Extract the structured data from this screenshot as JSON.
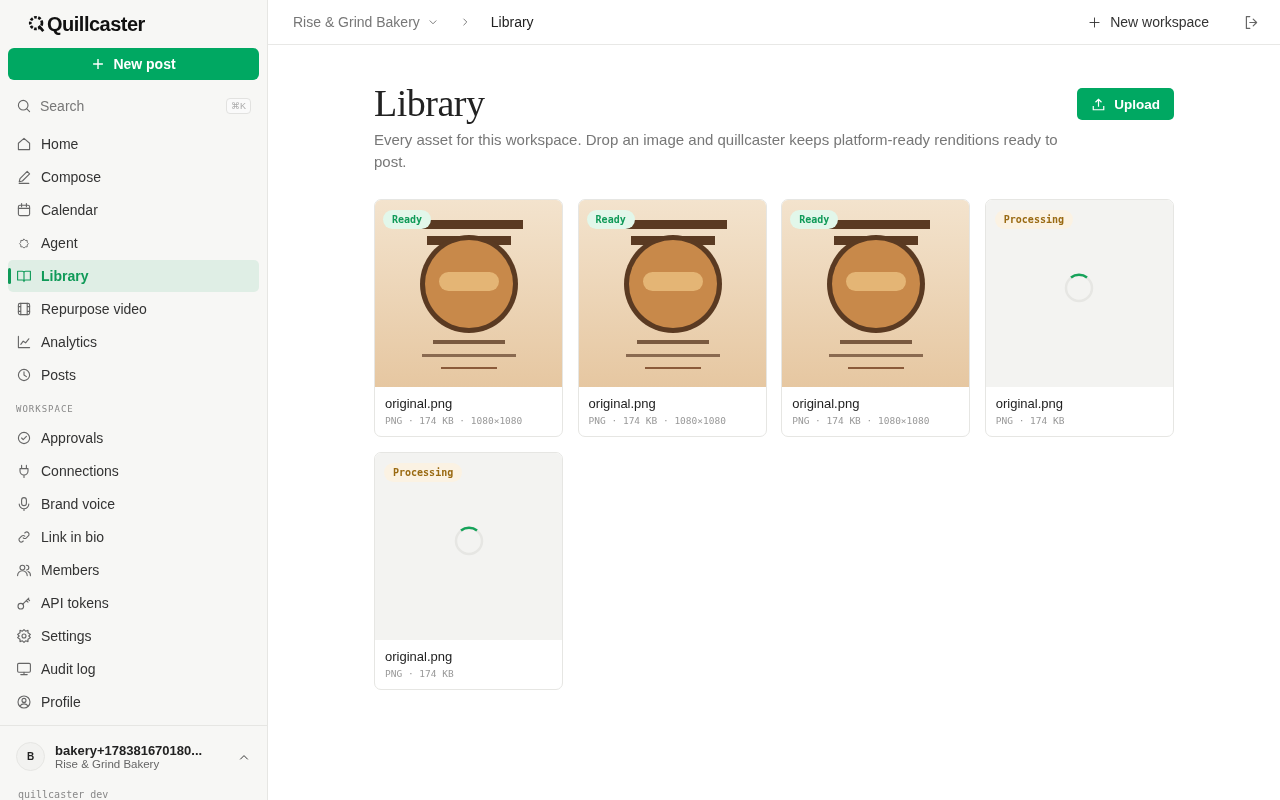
{
  "sidebar": {
    "logo": "Quillcaster",
    "new_post": "New post",
    "search": {
      "placeholder": "Search",
      "shortcut": "⌘K"
    },
    "items": [
      {
        "label": "Home",
        "selected": false
      },
      {
        "label": "Compose",
        "selected": false
      },
      {
        "label": "Calendar",
        "selected": false
      },
      {
        "label": "Agent",
        "selected": false
      },
      {
        "label": "Library",
        "selected": true
      },
      {
        "label": "Repurpose video",
        "selected": false
      },
      {
        "label": "Analytics",
        "selected": false
      },
      {
        "label": "Posts",
        "selected": false
      }
    ],
    "section_label": "WORKSPACE",
    "workspace_items": [
      {
        "label": "Approvals",
        "selected": false
      },
      {
        "label": "Connections",
        "selected": false
      },
      {
        "label": "Brand voice",
        "selected": false
      },
      {
        "label": "Link in bio",
        "selected": false
      },
      {
        "label": "Members",
        "selected": false
      },
      {
        "label": "API tokens",
        "selected": false
      },
      {
        "label": "Settings",
        "selected": false
      },
      {
        "label": "Audit log",
        "selected": false
      },
      {
        "label": "Profile",
        "selected": false
      }
    ],
    "account": {
      "initial": "B",
      "name": "bakery+178381670180...",
      "workspace": "Rise & Grind Bakery"
    },
    "footer": "quillcaster dev"
  },
  "topbar": {
    "workspace": "Rise & Grind Bakery",
    "page": "Library",
    "new_workspace": "New workspace"
  },
  "header": {
    "title": "Library",
    "description": "Every asset for this workspace. Drop an image and quillcaster keeps platform-ready renditions ready to post.",
    "upload": "Upload"
  },
  "assets": [
    {
      "kind": "ready",
      "badge": "Ready",
      "name": "original.png",
      "meta": "PNG · 174 KB · 1080×1080"
    },
    {
      "kind": "ready",
      "badge": "Ready",
      "name": "original.png",
      "meta": "PNG · 174 KB · 1080×1080"
    },
    {
      "kind": "ready",
      "badge": "Ready",
      "name": "original.png",
      "meta": "PNG · 174 KB · 1080×1080"
    },
    {
      "kind": "processing",
      "badge": "Processing",
      "name": "original.png",
      "meta": "PNG · 174 KB"
    },
    {
      "kind": "processing",
      "badge": "Processing",
      "name": "original.png",
      "meta": "PNG · 174 KB"
    }
  ]
}
